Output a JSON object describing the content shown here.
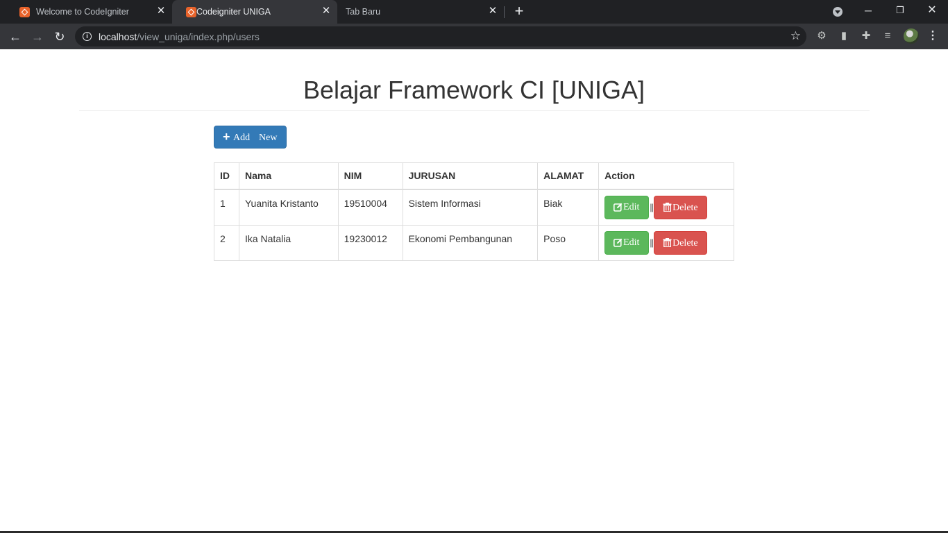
{
  "browser": {
    "tabs": [
      {
        "title": "Welcome to CodeIgniter",
        "active": false
      },
      {
        "title": "Codeigniter UNIGA",
        "active": true
      },
      {
        "title": "Tab Baru",
        "active": false
      }
    ],
    "url_host": "localhost",
    "url_path": "/view_uniga/index.php/users"
  },
  "page": {
    "heading": "Belajar Framework CI [UNIGA]",
    "add_button": {
      "label_1": "Add",
      "label_2": "New"
    },
    "table": {
      "headers": {
        "id": "ID",
        "nama": "Nama",
        "nim": "NIM",
        "jurusan": "JURUSAN",
        "alamat": "ALAMAT",
        "action": "Action"
      },
      "rows": [
        {
          "id": "1",
          "nama": "Yuanita Kristanto",
          "nim": "19510004",
          "jurusan": "Sistem Informasi",
          "alamat": "Biak",
          "edit_label": "Edit",
          "separator": "||",
          "delete_label": "Delete"
        },
        {
          "id": "2",
          "nama": "Ika Natalia",
          "nim": "19230012",
          "jurusan": "Ekonomi Pembangunan",
          "alamat": "Poso",
          "edit_label": "Edit",
          "separator": "||",
          "delete_label": "Delete"
        }
      ]
    }
  },
  "colors": {
    "primary": "#337ab7",
    "success": "#5cb85c",
    "danger": "#d9534f",
    "chrome_dark": "#202124",
    "chrome_toolbar": "#35363a"
  },
  "icons": {
    "tab_favicon": "codeigniter-icon",
    "add": "plus-icon",
    "edit": "edit-square-icon",
    "delete": "trash-icon"
  }
}
